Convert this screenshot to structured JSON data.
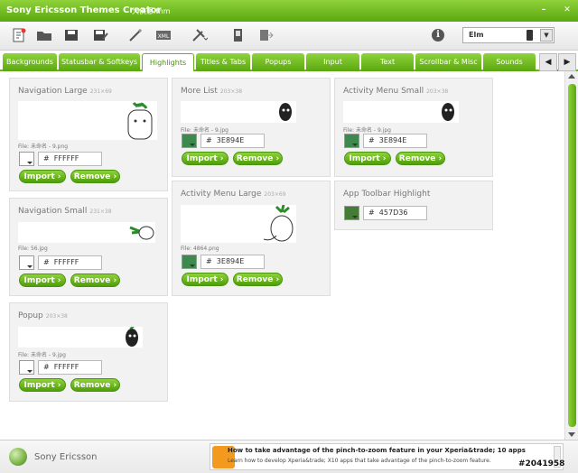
{
  "window": {
    "app_title": "Sony Ericsson Themes Creator",
    "file_name": "大侠患.thm"
  },
  "toolbar": {
    "theme_value": "Elm"
  },
  "tabs": [
    {
      "label": "Backgrounds"
    },
    {
      "label": "Statusbar & Softkeys"
    },
    {
      "label": "Highlights"
    },
    {
      "label": "Titles & Tabs"
    },
    {
      "label": "Popups"
    },
    {
      "label": "Input"
    },
    {
      "label": "Text"
    },
    {
      "label": "Scrollbar & Misc"
    },
    {
      "label": "Sounds"
    }
  ],
  "buttons": {
    "import": "Import",
    "remove": "Remove"
  },
  "hash": "#",
  "panels": {
    "nav_large": {
      "title": "Navigation Large",
      "size": "231×69",
      "file": "File: 未命名 - 9.png",
      "color": "FFFFFF",
      "swatch": "#ffffff"
    },
    "nav_small": {
      "title": "Navigation Small",
      "size": "231×38",
      "file": "File: 56.jpg",
      "color": "FFFFFF",
      "swatch": "#ffffff"
    },
    "popup": {
      "title": "Popup",
      "size": "203×38",
      "file": "File: 未命名 - 9.jpg",
      "color": "FFFFFF",
      "swatch": "#ffffff"
    },
    "more_list": {
      "title": "More List",
      "size": "203×38",
      "file": "File: 未命名 - 9.jpg",
      "color": "3E894E",
      "swatch": "#3e894e"
    },
    "act_large": {
      "title": "Activity Menu Large",
      "size": "203×69",
      "file": "File: 4864.png",
      "color": "3E894E",
      "swatch": "#3e894e"
    },
    "act_small": {
      "title": "Activity Menu Small",
      "size": "203×38",
      "file": "File: 未命名 - 9.jpg",
      "color": "3E894E",
      "swatch": "#3e894e"
    },
    "app_toolbar": {
      "title": "App Toolbar Highlight",
      "color": "457D36",
      "swatch": "#457d36"
    }
  },
  "footer": {
    "brand": "Sony Ericsson",
    "news_title": "How to take advantage of the pinch-to-zoom feature in your Xperia&trade; 10 apps",
    "news_sub": "Learn how to develop Xperia&trade; X10 apps that take advantage of the pinch-to-zoom feature."
  },
  "watermark": "#2041958"
}
